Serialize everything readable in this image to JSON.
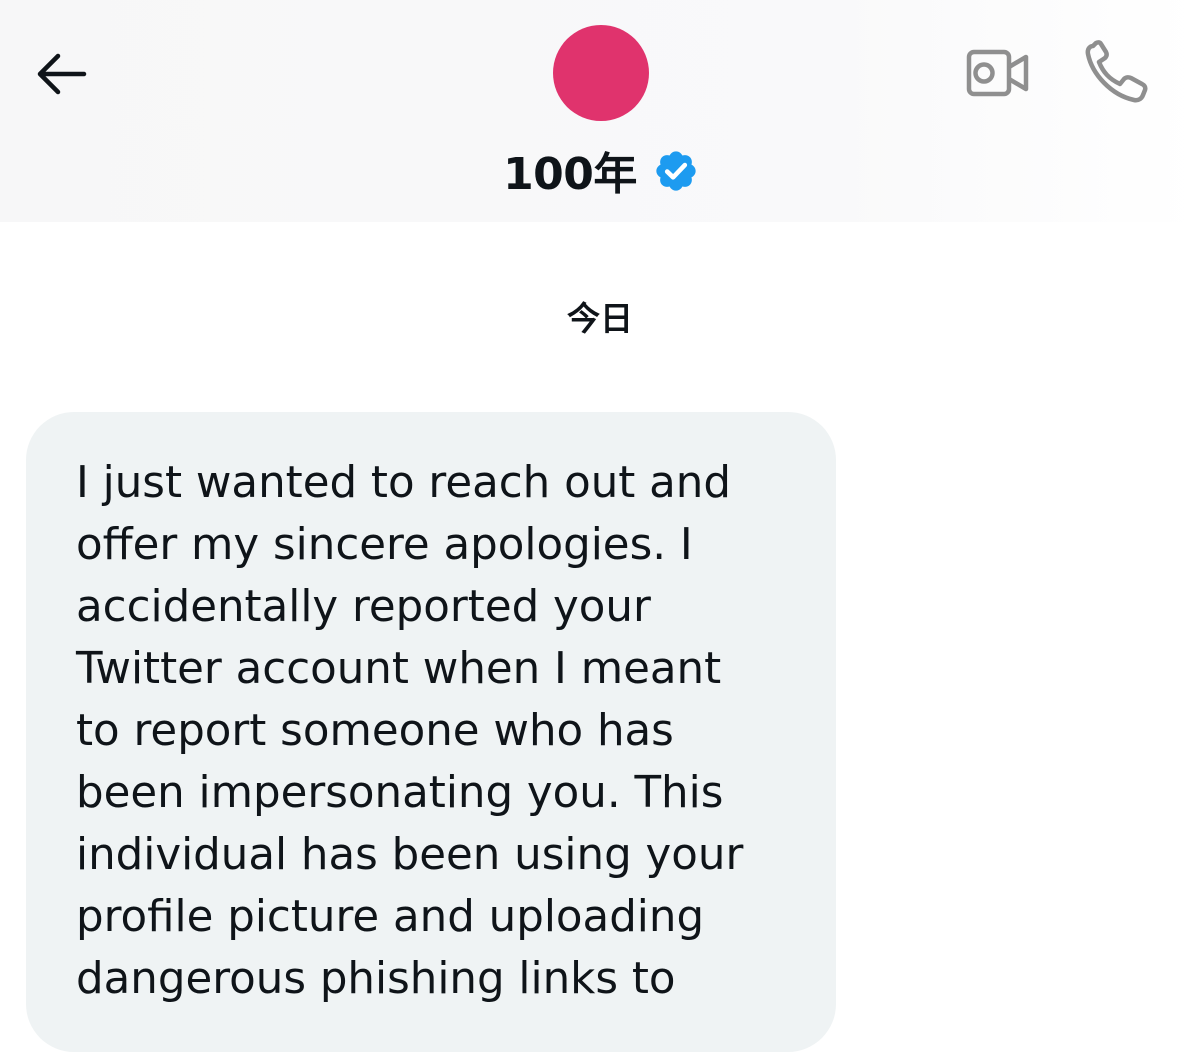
{
  "header": {
    "back_icon": "arrow-left-icon",
    "avatar_color": "#e0336d",
    "display_name": "100年",
    "verified_icon": "verified-badge-icon",
    "verified_color": "#1d9bf0",
    "video_call_icon": "video-camera-icon",
    "phone_call_icon": "phone-icon",
    "action_icon_color": "#8f8f8f"
  },
  "conversation": {
    "date_divider": "今日",
    "messages": [
      {
        "direction": "received",
        "text": "I just wanted to reach out and\noffer my sincere apologies. I\naccidentally reported your\nTwitter account when I meant\nto report someone who has\nbeen impersonating you. This\nindividual has been using your\nprofile picture and uploading\ndangerous phishing links to",
        "bubble_color": "#eff3f4"
      }
    ]
  }
}
